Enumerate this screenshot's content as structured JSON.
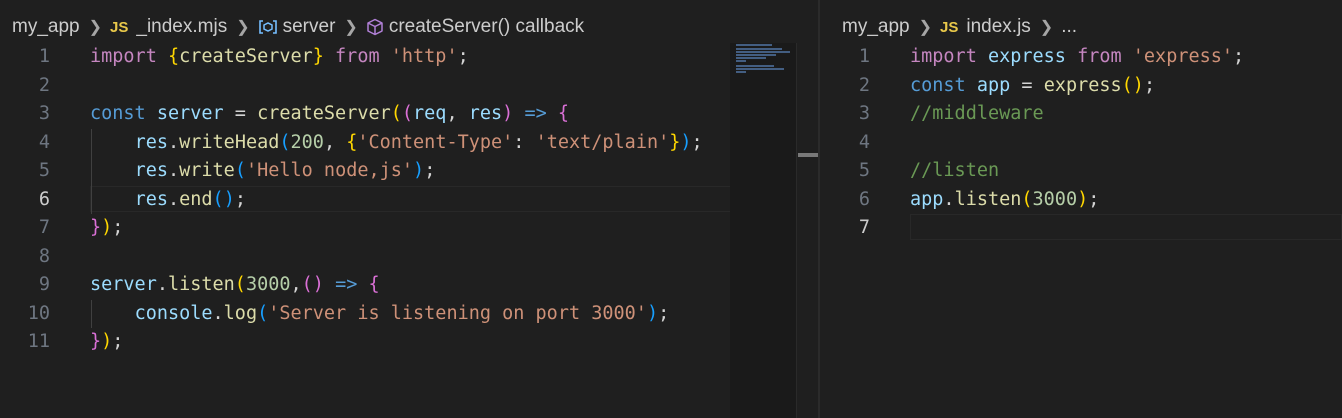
{
  "left_editor": {
    "breadcrumb": {
      "folder": "my_app",
      "file_badge": "JS",
      "file": "_index.mjs",
      "variable": "server",
      "function": "createServer() callback"
    },
    "active_line": 6,
    "lines": [
      {
        "n": "1",
        "tokens": [
          [
            "import",
            "imp"
          ],
          [
            " ",
            ""
          ],
          [
            "{",
            "b1"
          ],
          [
            "createServer",
            "fn"
          ],
          [
            "}",
            "b1"
          ],
          [
            " ",
            ""
          ],
          [
            "from",
            "imp"
          ],
          [
            " ",
            ""
          ],
          [
            "'http'",
            "str"
          ],
          [
            ";",
            ""
          ]
        ]
      },
      {
        "n": "2",
        "tokens": []
      },
      {
        "n": "3",
        "tokens": [
          [
            "const",
            "kw"
          ],
          [
            " ",
            ""
          ],
          [
            "server",
            "var"
          ],
          [
            " = ",
            ""
          ],
          [
            "createServer",
            "fn"
          ],
          [
            "(",
            "b1"
          ],
          [
            "(",
            "b2"
          ],
          [
            "req",
            "var"
          ],
          [
            ", ",
            ""
          ],
          [
            "res",
            "var"
          ],
          [
            ")",
            "b2"
          ],
          [
            " ",
            ""
          ],
          [
            "=>",
            "kw"
          ],
          [
            " ",
            ""
          ],
          [
            "{",
            "b2"
          ]
        ]
      },
      {
        "n": "4",
        "guide": true,
        "tokens": [
          [
            "    ",
            ""
          ],
          [
            "res",
            "var"
          ],
          [
            ".",
            ""
          ],
          [
            "writeHead",
            "fn"
          ],
          [
            "(",
            "b3"
          ],
          [
            "200",
            "num"
          ],
          [
            ", ",
            ""
          ],
          [
            "{",
            "b1"
          ],
          [
            "'Content-Type'",
            "str"
          ],
          [
            ": ",
            ""
          ],
          [
            "'text/plain'",
            "str"
          ],
          [
            "}",
            "b1"
          ],
          [
            ")",
            "b3"
          ],
          [
            ";",
            ""
          ]
        ]
      },
      {
        "n": "5",
        "guide": true,
        "tokens": [
          [
            "    ",
            ""
          ],
          [
            "res",
            "var"
          ],
          [
            ".",
            ""
          ],
          [
            "write",
            "fn"
          ],
          [
            "(",
            "b3"
          ],
          [
            "'Hello node,js'",
            "str"
          ],
          [
            ")",
            "b3"
          ],
          [
            ";",
            ""
          ]
        ]
      },
      {
        "n": "6",
        "guide": true,
        "tokens": [
          [
            "    ",
            ""
          ],
          [
            "res",
            "var"
          ],
          [
            ".",
            ""
          ],
          [
            "end",
            "fn"
          ],
          [
            "(",
            "b3"
          ],
          [
            ")",
            "b3"
          ],
          [
            ";",
            ""
          ]
        ]
      },
      {
        "n": "7",
        "tokens": [
          [
            "}",
            "b2"
          ],
          [
            ")",
            "b1"
          ],
          [
            ";",
            ""
          ]
        ]
      },
      {
        "n": "8",
        "tokens": []
      },
      {
        "n": "9",
        "tokens": [
          [
            "server",
            "var"
          ],
          [
            ".",
            ""
          ],
          [
            "listen",
            "fn"
          ],
          [
            "(",
            "b1"
          ],
          [
            "3000",
            "num"
          ],
          [
            ",",
            ""
          ],
          [
            "(",
            "b2"
          ],
          [
            ")",
            "b2"
          ],
          [
            " ",
            ""
          ],
          [
            "=>",
            "kw"
          ],
          [
            " ",
            ""
          ],
          [
            "{",
            "b2"
          ]
        ]
      },
      {
        "n": "10",
        "guide": true,
        "tokens": [
          [
            "    ",
            ""
          ],
          [
            "console",
            "var"
          ],
          [
            ".",
            ""
          ],
          [
            "log",
            "fn"
          ],
          [
            "(",
            "b3"
          ],
          [
            "'Server is listening on port 3000'",
            "str"
          ],
          [
            ")",
            "b3"
          ],
          [
            ";",
            ""
          ]
        ]
      },
      {
        "n": "11",
        "tokens": [
          [
            "}",
            "b2"
          ],
          [
            ")",
            "b1"
          ],
          [
            ";",
            ""
          ]
        ]
      }
    ]
  },
  "right_editor": {
    "breadcrumb": {
      "folder": "my_app",
      "file_badge": "JS",
      "file": "index.js",
      "more": "..."
    },
    "active_line": 7,
    "lines": [
      {
        "n": "1",
        "tokens": [
          [
            "import",
            "imp"
          ],
          [
            " ",
            ""
          ],
          [
            "express",
            "var"
          ],
          [
            " ",
            ""
          ],
          [
            "from",
            "imp"
          ],
          [
            " ",
            ""
          ],
          [
            "'express'",
            "str"
          ],
          [
            ";",
            ""
          ]
        ]
      },
      {
        "n": "2",
        "tokens": [
          [
            "const",
            "kw"
          ],
          [
            " ",
            ""
          ],
          [
            "app",
            "var"
          ],
          [
            " = ",
            ""
          ],
          [
            "express",
            "fn"
          ],
          [
            "(",
            "b1"
          ],
          [
            ")",
            "b1"
          ],
          [
            ";",
            ""
          ]
        ]
      },
      {
        "n": "3",
        "tokens": [
          [
            "//middleware",
            "cm"
          ]
        ]
      },
      {
        "n": "4",
        "tokens": []
      },
      {
        "n": "5",
        "tokens": [
          [
            "//listen",
            "cm"
          ]
        ]
      },
      {
        "n": "6",
        "tokens": [
          [
            "app",
            "var"
          ],
          [
            ".",
            ""
          ],
          [
            "listen",
            "fn"
          ],
          [
            "(",
            "b1"
          ],
          [
            "3000",
            "num"
          ],
          [
            ")",
            "b1"
          ],
          [
            ";",
            ""
          ]
        ]
      },
      {
        "n": "7",
        "tokens": []
      }
    ]
  },
  "colors": {
    "editor_background": "#1f1f1f",
    "keyword": "#569cd6",
    "control_keyword": "#c586c0",
    "variable": "#9cdcfe",
    "function": "#dcdcaa",
    "string": "#ce9178",
    "number": "#b5cea8",
    "comment": "#6a9955"
  }
}
